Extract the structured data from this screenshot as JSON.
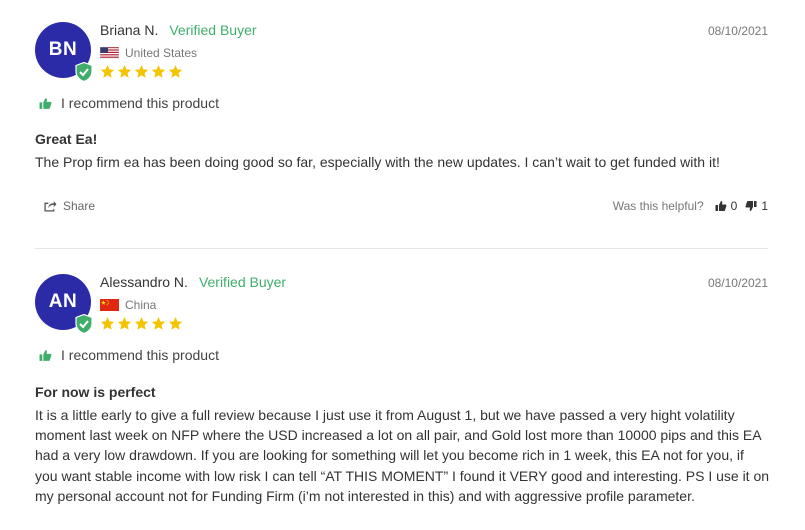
{
  "reviews": [
    {
      "initials": "BN",
      "name": "Briana N.",
      "verified": "Verified Buyer",
      "date": "08/10/2021",
      "country": "United States",
      "flag": "us-flag",
      "rating": 5,
      "recommend": "I recommend this product",
      "title": "Great Ea!",
      "body": "The Prop firm ea has been doing good so far, especially with the new updates. I can’t wait to get funded with it!",
      "share": "Share",
      "helpful_question": "Was this helpful?",
      "thumbs_up": "0",
      "thumbs_down": "1"
    },
    {
      "initials": "AN",
      "name": "Alessandro N.",
      "verified": "Verified Buyer",
      "date": "08/10/2021",
      "country": "China",
      "flag": "china-flag",
      "rating": 5,
      "recommend": "I recommend this product",
      "title": "For now is perfect",
      "body": "It is a little early to give a full review because I just use it from August 1, but we have passed a very hight volatility moment last week on NFP where the USD increased a lot on all pair, and Gold lost more than 10000 pips and this EA had a very low drawdown. If you are looking for something will let you become rich in 1 week, this EA not for you, if you want stable income with low risk I can tell “AT THIS MOMENT” I found it VERY good and interesting. PS I use it on my personal account not for Funding Firm (i’m not interested in this) and with aggressive profile parameter."
    }
  ],
  "colors": {
    "avatar": "#2b2ba8",
    "verified": "#3fae6b",
    "star": "#f5c400"
  }
}
